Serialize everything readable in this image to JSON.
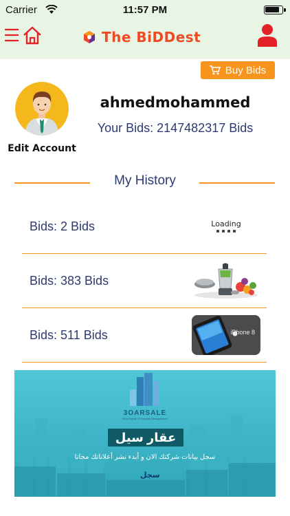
{
  "status_bar": {
    "carrier": "Carrier",
    "time": "11:57 PM"
  },
  "header": {
    "brand": "The BiDDest",
    "accent_color": "#ef4a24"
  },
  "buy_bids": {
    "label": "Buy Bids",
    "color": "#f7941d"
  },
  "profile": {
    "edit_label": "Edit Account",
    "username": "ahmedmohammed",
    "your_bids": "Your Bids: 2147482317 Bids"
  },
  "history": {
    "title": "My History",
    "items": [
      {
        "bids": "Bids: 2 Bids",
        "thumb": "loading-placeholder",
        "thumb_text": "Loading"
      },
      {
        "bids": "Bids: 383 Bids",
        "thumb": "blender-kitchen-set"
      },
      {
        "bids": "Bids: 511 Bids",
        "thumb": "iphone",
        "thumb_text": "iPhone 8"
      }
    ]
  },
  "ad": {
    "brand": "3OARSALE",
    "brand_sub": "Real Estate & Property Management",
    "title": "عقار سيل",
    "text": "سجل بيانات شركتك الان و أبدء نشر أعلاناتك مجانا",
    "cta": "سجل"
  }
}
